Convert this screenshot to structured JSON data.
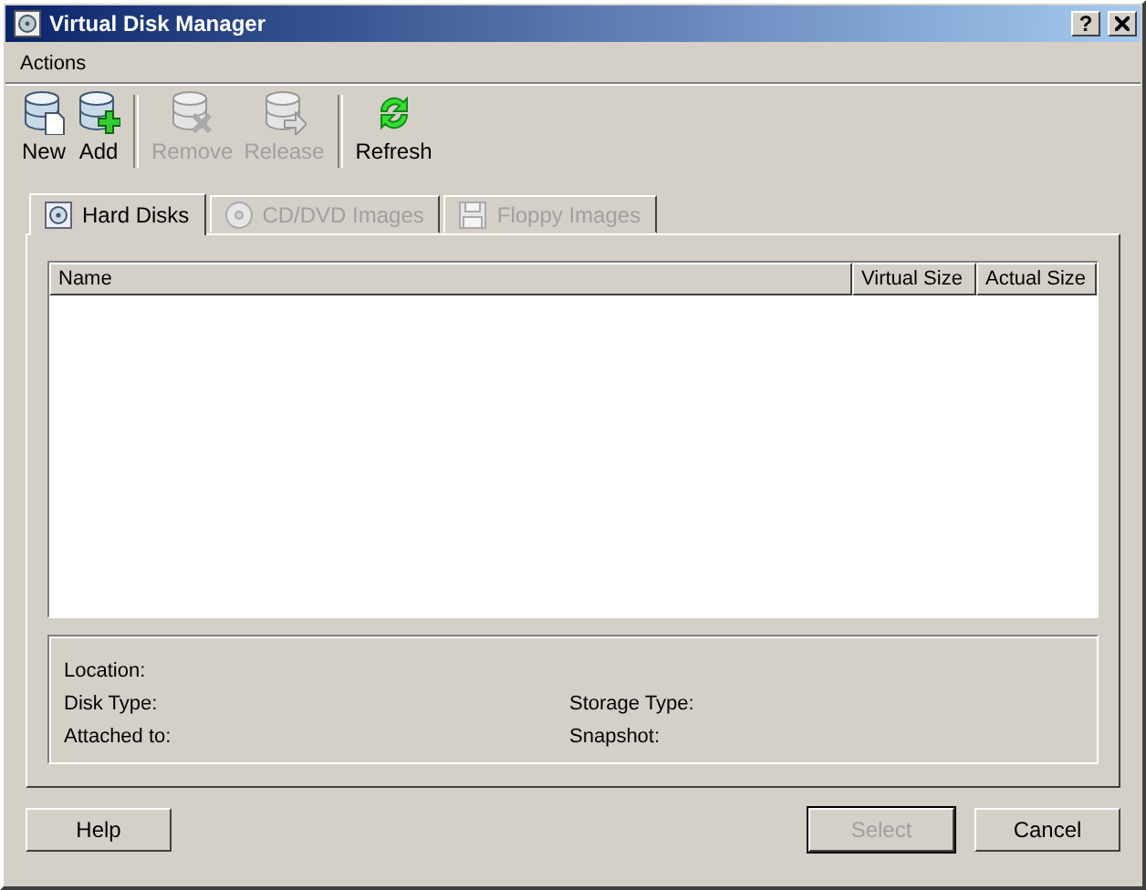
{
  "window": {
    "title": "Virtual Disk Manager",
    "help_button": "?"
  },
  "menu": [
    "Actions"
  ],
  "toolbar": [
    {
      "kind": "new",
      "label": "New",
      "disabled": false
    },
    {
      "kind": "add",
      "label": "Add",
      "disabled": false
    },
    {
      "kind": "remove",
      "label": "Remove",
      "disabled": true
    },
    {
      "kind": "release",
      "label": "Release",
      "disabled": true
    },
    {
      "kind": "refresh",
      "label": "Refresh",
      "disabled": false
    }
  ],
  "tabs": [
    {
      "kind": "hard-disk",
      "label": "Hard Disks",
      "selected": true,
      "disabled": false
    },
    {
      "kind": "cd",
      "label": "CD/DVD Images",
      "selected": false,
      "disabled": true
    },
    {
      "kind": "floppy",
      "label": "Floppy Images",
      "selected": false,
      "disabled": true
    }
  ],
  "table": {
    "columns": [
      "Name",
      "Virtual Size",
      "Actual Size"
    ]
  },
  "details": [
    [
      "Location:"
    ],
    [
      "Disk Type:",
      "Storage Type:"
    ],
    [
      "Attached to:",
      "Snapshot:"
    ]
  ],
  "buttons": [
    {
      "label": "Help",
      "disabled": false,
      "default": false
    },
    {
      "label": "Select",
      "disabled": true,
      "default": true
    },
    {
      "label": "Cancel",
      "disabled": false,
      "default": false
    }
  ]
}
